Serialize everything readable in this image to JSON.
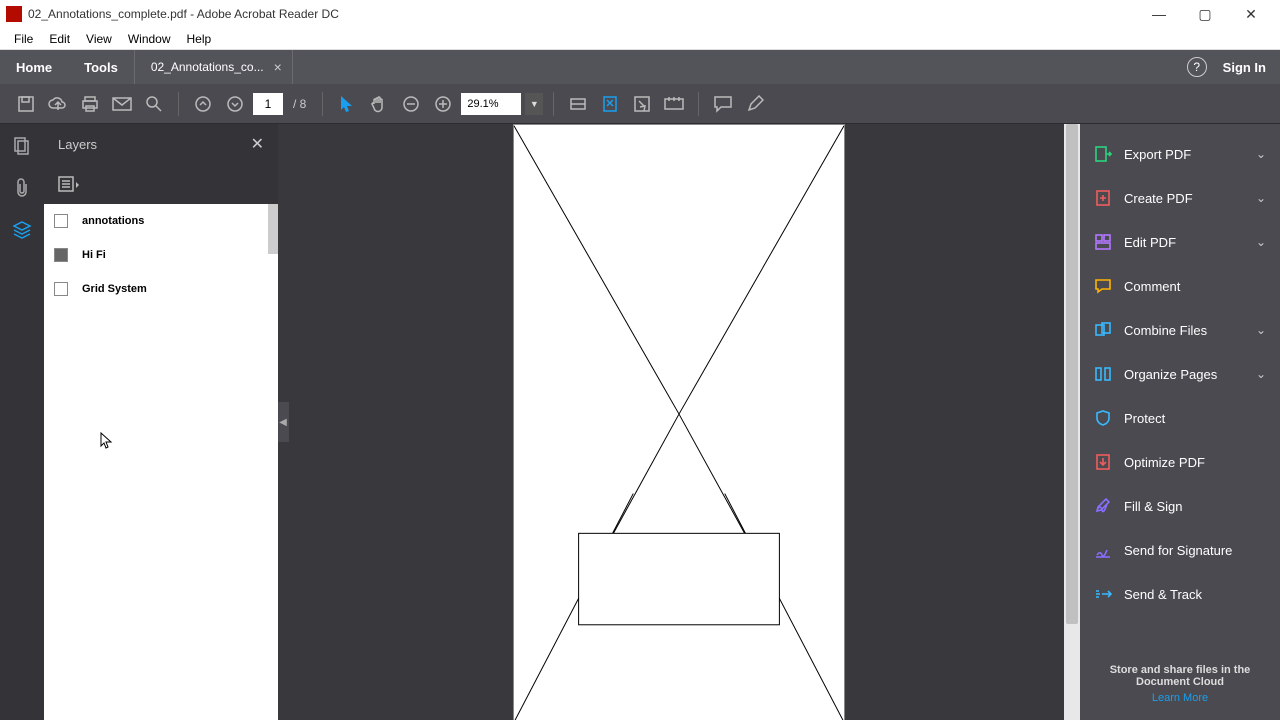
{
  "titlebar": {
    "title": "02_Annotations_complete.pdf - Adobe Acrobat Reader DC"
  },
  "menubar": {
    "items": [
      "File",
      "Edit",
      "View",
      "Window",
      "Help"
    ]
  },
  "tabbar": {
    "home": "Home",
    "tools": "Tools",
    "doc": "02_Annotations_co...",
    "signin": "Sign In"
  },
  "toolbar": {
    "page_current": "1",
    "page_total": "/ 8",
    "zoom": "29.1%"
  },
  "layers_panel": {
    "title": "Layers",
    "items": [
      {
        "label": "annotations",
        "checked": false
      },
      {
        "label": "Hi Fi",
        "checked": true
      },
      {
        "label": "Grid System",
        "checked": false
      }
    ]
  },
  "right_pane": {
    "items": [
      {
        "label": "Export PDF",
        "chev": true,
        "color": "#2bd47d"
      },
      {
        "label": "Create PDF",
        "chev": true,
        "color": "#f05c5c"
      },
      {
        "label": "Edit PDF",
        "chev": true,
        "color": "#b278ff"
      },
      {
        "label": "Comment",
        "chev": false,
        "color": "#ffb400"
      },
      {
        "label": "Combine Files",
        "chev": true,
        "color": "#38b9ff"
      },
      {
        "label": "Organize Pages",
        "chev": true,
        "color": "#38b9ff"
      },
      {
        "label": "Protect",
        "chev": false,
        "color": "#38b9ff"
      },
      {
        "label": "Optimize PDF",
        "chev": false,
        "color": "#f05c5c"
      },
      {
        "label": "Fill & Sign",
        "chev": false,
        "color": "#8a6eff"
      },
      {
        "label": "Send for Signature",
        "chev": false,
        "color": "#8a6eff"
      },
      {
        "label": "Send & Track",
        "chev": false,
        "color": "#38b9ff"
      }
    ],
    "footer": "Store and share files in the Document Cloud",
    "footer_link": "Learn More"
  }
}
